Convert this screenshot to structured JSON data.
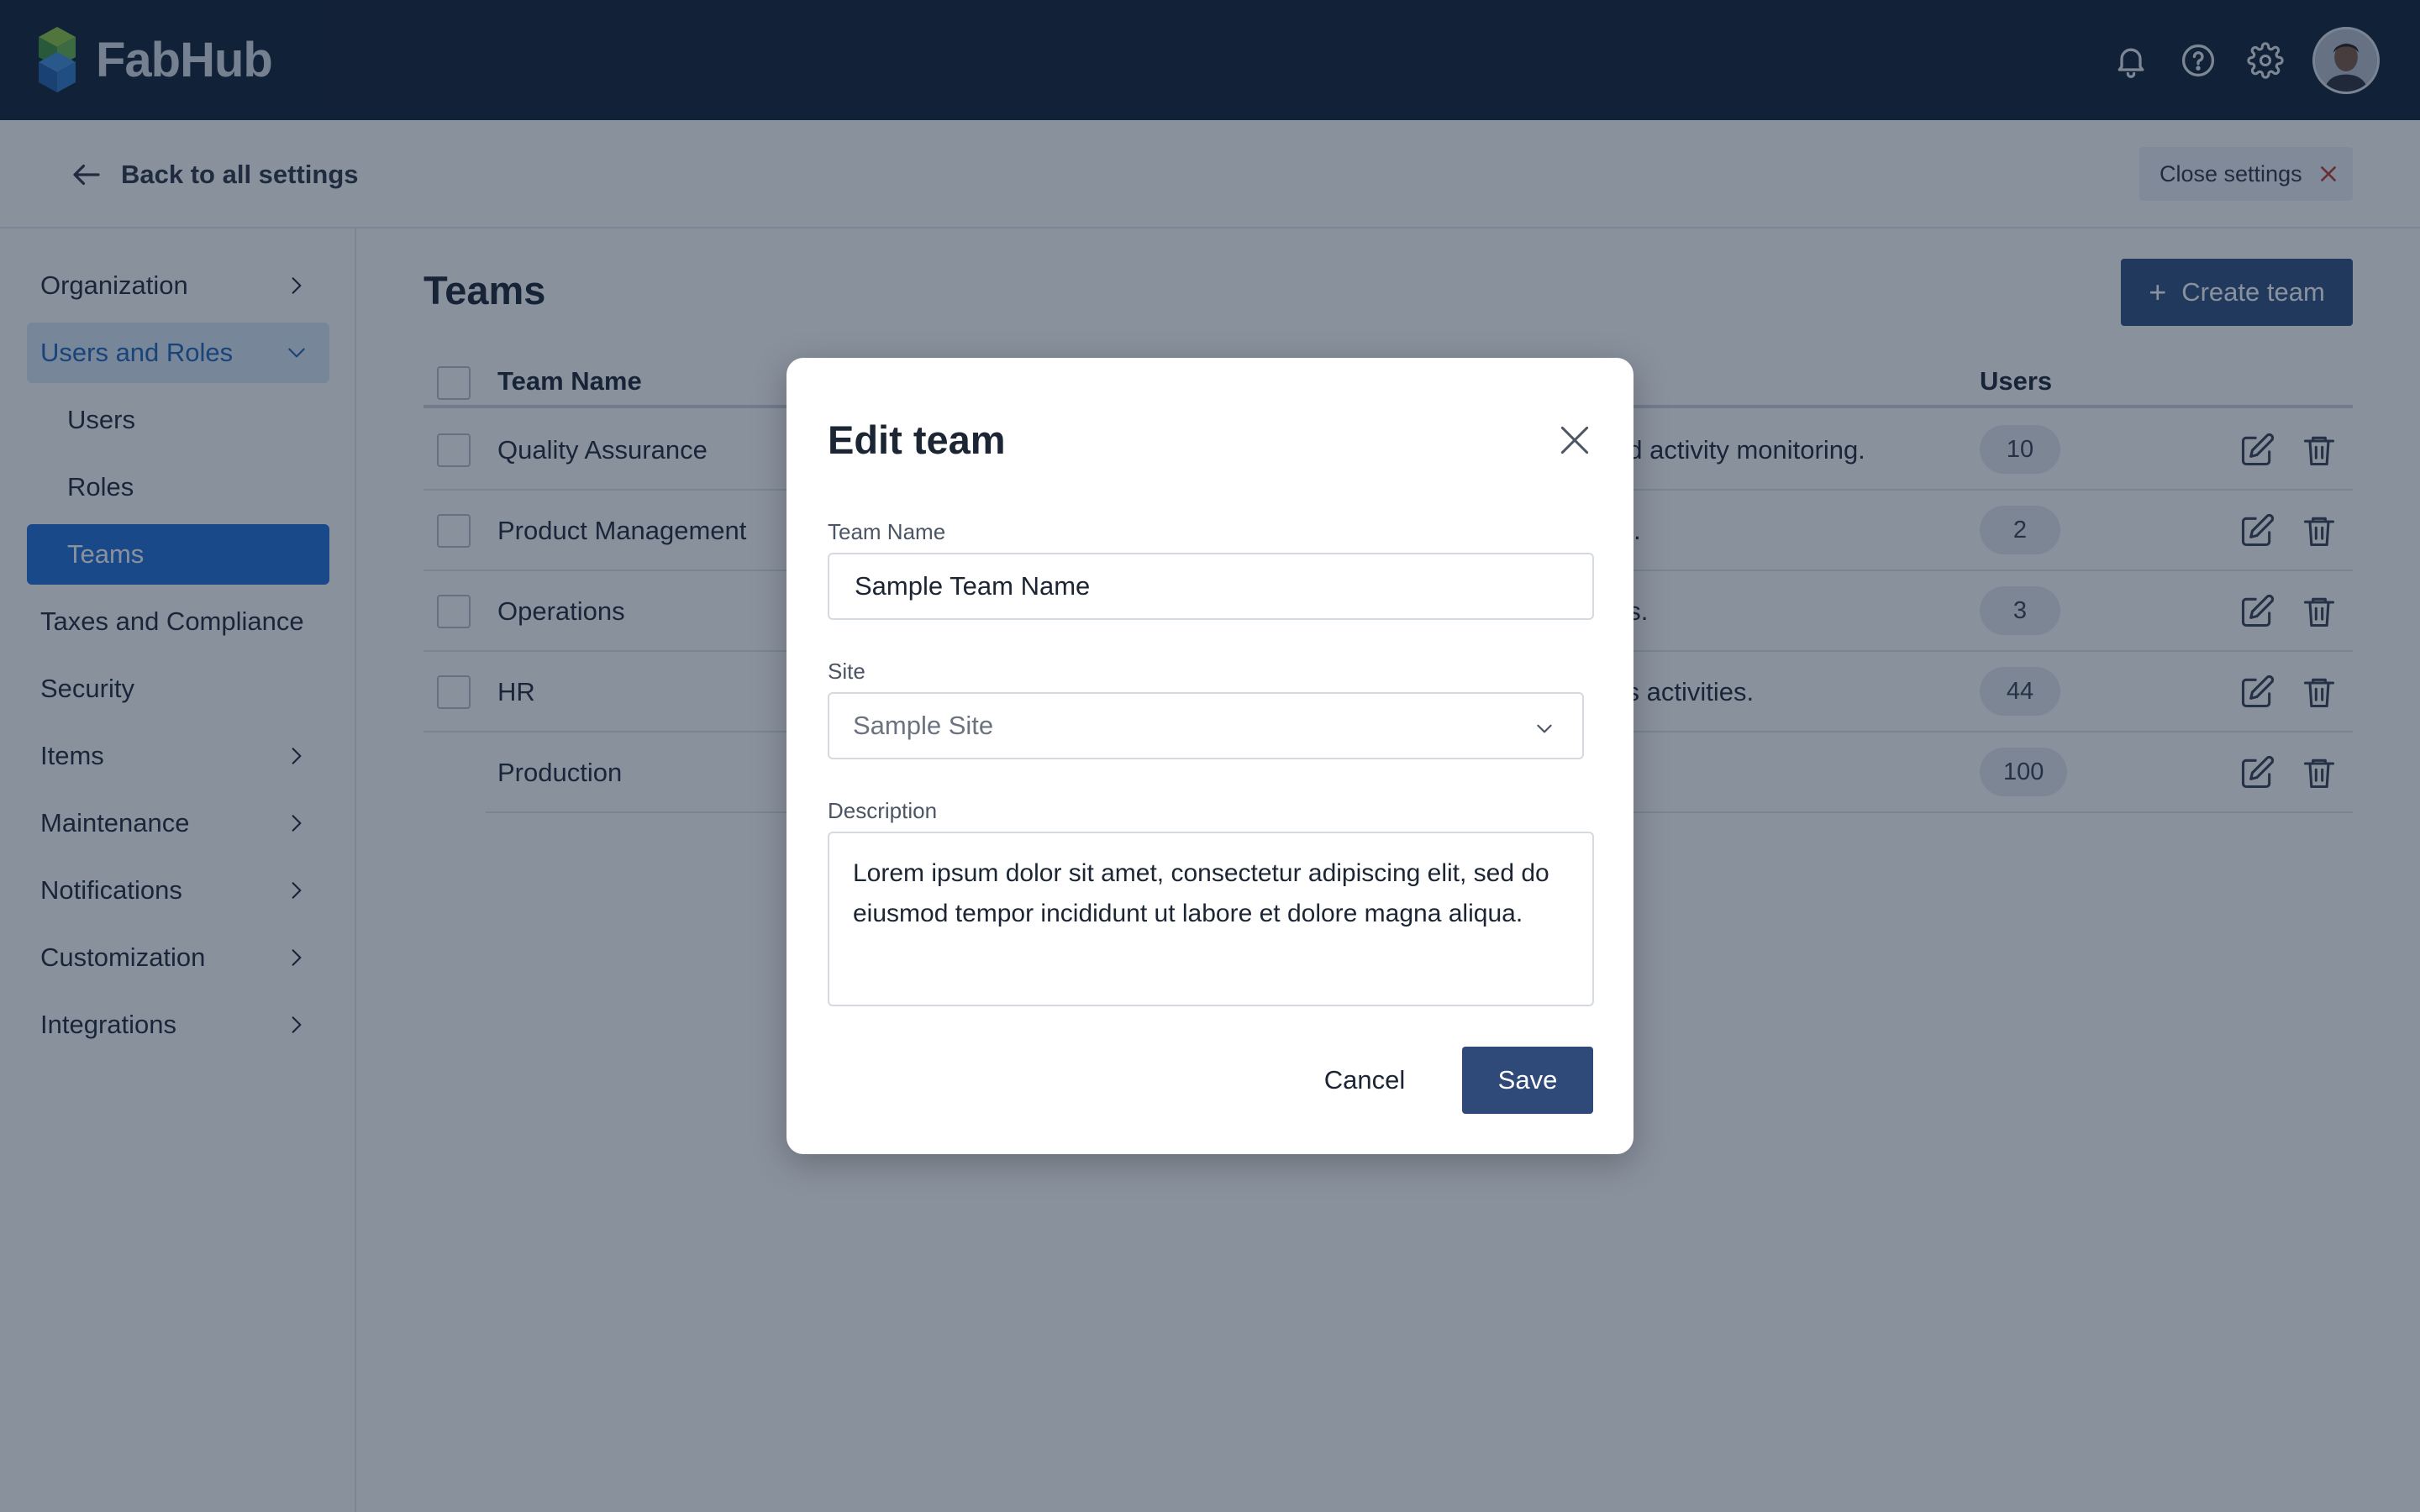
{
  "app": {
    "name": "FabHub"
  },
  "topbar": {
    "icons": [
      "bell-icon",
      "help-icon",
      "gear-icon"
    ],
    "avatar": "user-avatar"
  },
  "subbar": {
    "back_label": "Back to all settings",
    "close_label": "Close settings"
  },
  "sidebar": {
    "items": [
      {
        "label": "Organization",
        "chevron": "right"
      },
      {
        "label": "Users and Roles",
        "chevron": "down",
        "state": "open"
      },
      {
        "label": "Users",
        "sub": true
      },
      {
        "label": "Roles",
        "sub": true
      },
      {
        "label": "Teams",
        "sub": true,
        "state": "active"
      },
      {
        "label": "Taxes and Compliance"
      },
      {
        "label": "Security"
      },
      {
        "label": "Items",
        "chevron": "right"
      },
      {
        "label": "Maintenance",
        "chevron": "right"
      },
      {
        "label": "Notifications",
        "chevron": "right"
      },
      {
        "label": "Customization",
        "chevron": "right"
      },
      {
        "label": "Integrations",
        "chevron": "right"
      }
    ]
  },
  "main": {
    "title": "Teams",
    "create_label": "Create team",
    "columns": {
      "team_name": "Team Name",
      "users": "Users"
    },
    "rows": [
      {
        "name": "Quality Assurance",
        "desc_visible": "nd activity monitoring.",
        "users": "10",
        "checkbox": true
      },
      {
        "name": "Product Management",
        "desc_visible": "ts.",
        "users": "2",
        "checkbox": true
      },
      {
        "name": "Operations",
        "desc_visible": "es.",
        "users": "3",
        "checkbox": true
      },
      {
        "name": "HR",
        "desc_visible": "ks activities.",
        "users": "44",
        "checkbox": true
      },
      {
        "name": "Production",
        "desc_visible": "",
        "users": "100",
        "checkbox": false
      }
    ]
  },
  "modal": {
    "title": "Edit team",
    "team_name_label": "Team Name",
    "team_name_value": "Sample Team Name",
    "site_label": "Site",
    "site_value": "Sample Site",
    "description_label": "Description",
    "description_value": "Lorem ipsum dolor sit amet, consectetur adipiscing elit, sed do eiusmod tempor incididunt ut labore et dolore magna aliqua.",
    "cancel_label": "Cancel",
    "save_label": "Save"
  },
  "colors": {
    "topbar": "#0f1e33",
    "primary_button": "#2f4f7f",
    "active_nav": "#1e6fd4",
    "open_nav": "#dbe8f6",
    "delete_icon": "#c0392b"
  }
}
